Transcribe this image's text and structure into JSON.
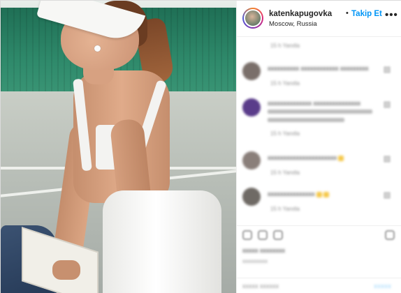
{
  "header": {
    "username": "katenkapugovka",
    "separator": "•",
    "follow_label": "Takip Et",
    "location": "Moscow, Russia",
    "more_icon": "ellipsis-icon",
    "more_glyph": "•••"
  },
  "comments": [
    {
      "text": "",
      "meta": "15 h  Yanıtla",
      "avatar_color": "#8a6a5a"
    },
    {
      "text": "xxxxxxxxxx xxxxxxxxxxxx xxxxxxxxx",
      "meta": "15 h  Yanıtla",
      "avatar_color": "#7a6f6a"
    },
    {
      "text": "xxxxxxxxxxxxxx xxxxxxxxxxxxxxx",
      "meta": "15 h  Yanıtla",
      "avatar_color": "#5a3c8a"
    },
    {
      "text": "xxxxxxxxxxxxxxxxxxxxxx",
      "meta": "15 h  Yanıtla",
      "avatar_color": "#8a7f7a"
    },
    {
      "text": "xxxxxxxxxxxxxxx",
      "meta": "15 h  Yanıtla",
      "avatar_color": "#6f6a65"
    }
  ],
  "footer": {
    "likes": "xxxxx xxxxxxxx",
    "date": "xxxxxxxxx",
    "add_comment_placeholder": "xxxxx xxxxxx",
    "post_label": "xxxxx"
  }
}
